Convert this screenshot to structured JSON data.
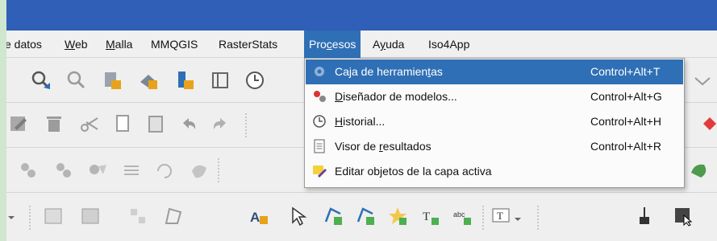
{
  "menubar": {
    "items": [
      {
        "pre": "",
        "u": "",
        "post": "e datos"
      },
      {
        "pre": "",
        "u": "W",
        "post": "eb"
      },
      {
        "pre": "",
        "u": "M",
        "post": "alla"
      },
      {
        "pre": "",
        "u": "",
        "post": "MMQGIS"
      },
      {
        "pre": "",
        "u": "",
        "post": "RasterStats"
      },
      {
        "pre": "Pro",
        "u": "c",
        "post": "esos"
      },
      {
        "pre": "A",
        "u": "y",
        "post": "uda"
      },
      {
        "pre": "",
        "u": "",
        "post": "Iso4App"
      }
    ]
  },
  "procesos_menu": {
    "items": [
      {
        "icon": "gear-icon",
        "pre": "Caja de herramien",
        "u": "t",
        "post": "as",
        "shortcut": "Control+Alt+T"
      },
      {
        "icon": "model-designer-icon",
        "pre": "",
        "u": "D",
        "post": "iseñador de modelos...",
        "shortcut": "Control+Alt+G"
      },
      {
        "icon": "history-clock-icon",
        "pre": "",
        "u": "H",
        "post": "istorial...",
        "shortcut": "Control+Alt+H"
      },
      {
        "icon": "document-icon",
        "pre": "Visor de ",
        "u": "r",
        "post": "esultados",
        "shortcut": "Control+Alt+R"
      },
      {
        "icon": "edit-pencil-icon",
        "pre": "Editar objetos de la capa activa",
        "u": "",
        "post": "",
        "shortcut": ""
      }
    ]
  },
  "colors": {
    "titlebar": "#2f5fb7",
    "highlight": "#2f6fb5",
    "menubar_bg": "#f0f0f0"
  }
}
